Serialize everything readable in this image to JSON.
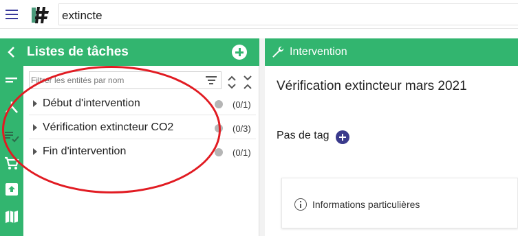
{
  "topbar": {
    "search_value": "extincte",
    "menu_icon": "hamburger-menu-icon",
    "logo_icon": "app-logo"
  },
  "leftnav": {
    "items": [
      {
        "icon": "chevron-left-icon"
      },
      {
        "icon": "short-text-icon"
      },
      {
        "icon": "share-network-icon"
      },
      {
        "icon": "playlist-check-icon"
      },
      {
        "icon": "cart-icon"
      },
      {
        "icon": "upload-box-icon"
      },
      {
        "icon": "map-icon"
      }
    ]
  },
  "tasks_panel": {
    "title": "Listes de tâches",
    "filter_placeholder": "Filtrer les entités par nom",
    "tasks": [
      {
        "label": "Début d'intervention",
        "count": "(0/1)"
      },
      {
        "label": "Vérification extincteur CO2",
        "count": "(0/3)"
      },
      {
        "label": "Fin d'intervention",
        "count": "(0/1)"
      }
    ],
    "annotation_color": "#e11b22"
  },
  "intervention": {
    "header": "Intervention",
    "title": "Vérification extincteur mars 2021",
    "tag_label": "Pas de tag",
    "info_label": "Informations particulières"
  },
  "colors": {
    "brand_green": "#32b56f",
    "accent_indigo": "#3a3a8c"
  }
}
